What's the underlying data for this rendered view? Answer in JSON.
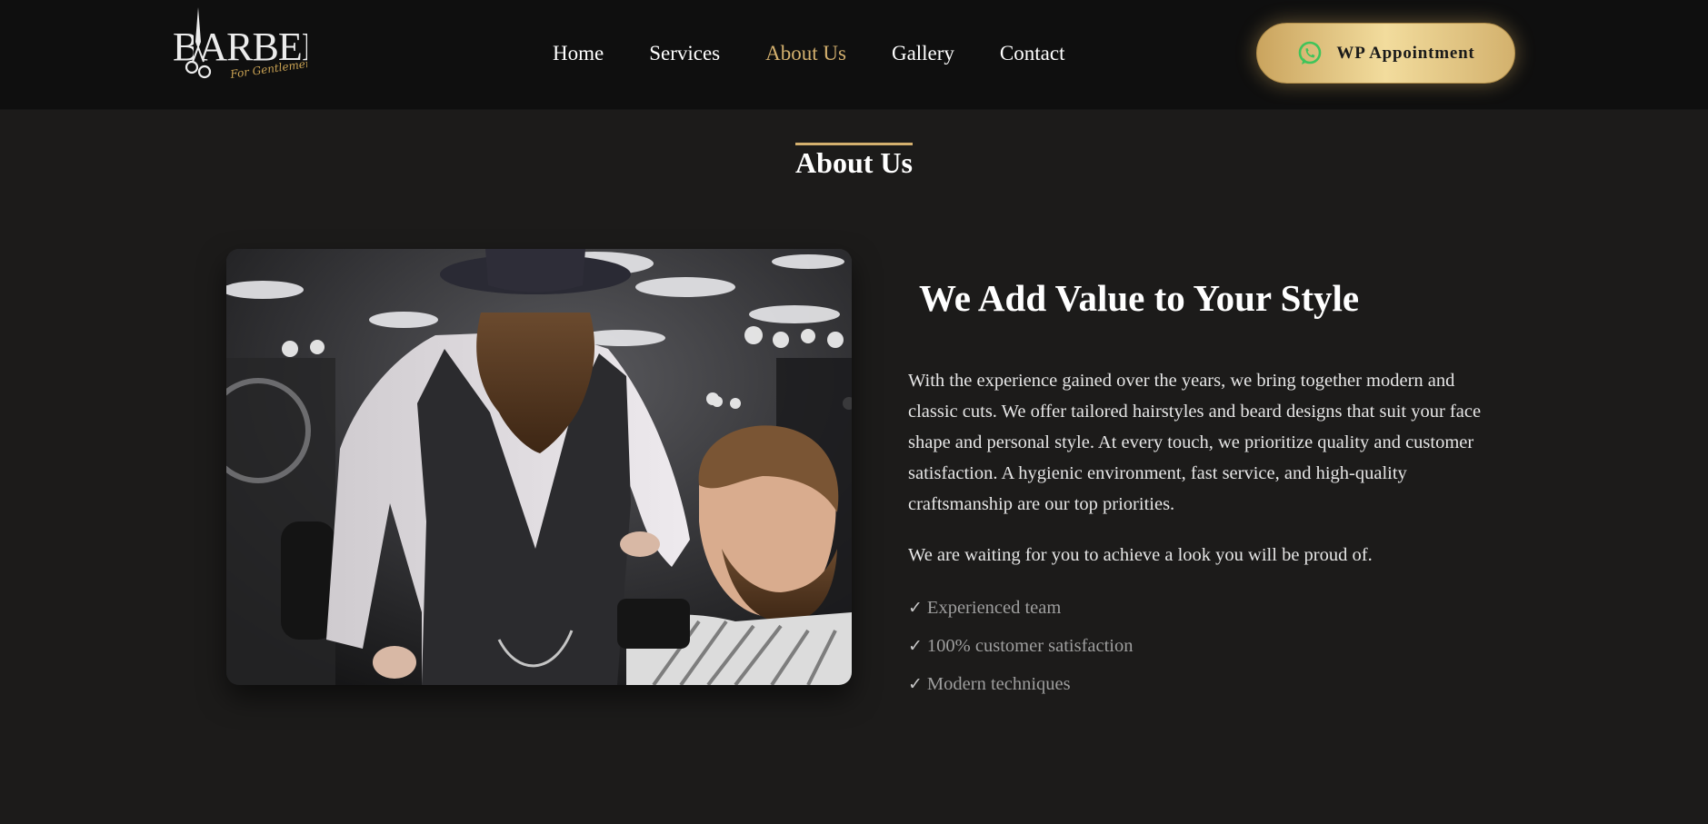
{
  "header": {
    "logo": {
      "text": "BARBER",
      "subtext": "For Gentlemen"
    },
    "nav": [
      {
        "label": "Home",
        "active": false
      },
      {
        "label": "Services",
        "active": false
      },
      {
        "label": "About Us",
        "active": true
      },
      {
        "label": "Gallery",
        "active": false
      },
      {
        "label": "Contact",
        "active": false
      }
    ],
    "cta": {
      "label": "WP Appointment",
      "icon": "whatsapp-icon"
    }
  },
  "about": {
    "section_title": "About Us",
    "headline": "We Add Value to Your Style",
    "paragraph": "With the experience gained over the years, we bring together modern and classic cuts. We offer tailored hairstyles and beard designs that suit your face shape and personal style. At every touch, we prioritize quality and customer satisfaction. A hygienic environment, fast service, and high-quality craftsmanship are our top priorities.",
    "paragraph2": "We are waiting for you to achieve a look you will be proud of.",
    "features": [
      {
        "check": "✓",
        "text": "Experienced team"
      },
      {
        "check": "✓",
        "text": "100% customer satisfaction"
      },
      {
        "check": "✓",
        "text": "Modern techniques"
      }
    ],
    "image": {
      "subject": "barber-photo"
    }
  },
  "colors": {
    "accent": "#d4b06e",
    "header_bg": "#0f0f0f",
    "page_bg": "#1c1b1a",
    "button_gradient_mid": "#f2dc9d",
    "whatsapp": "#3fc45a"
  }
}
